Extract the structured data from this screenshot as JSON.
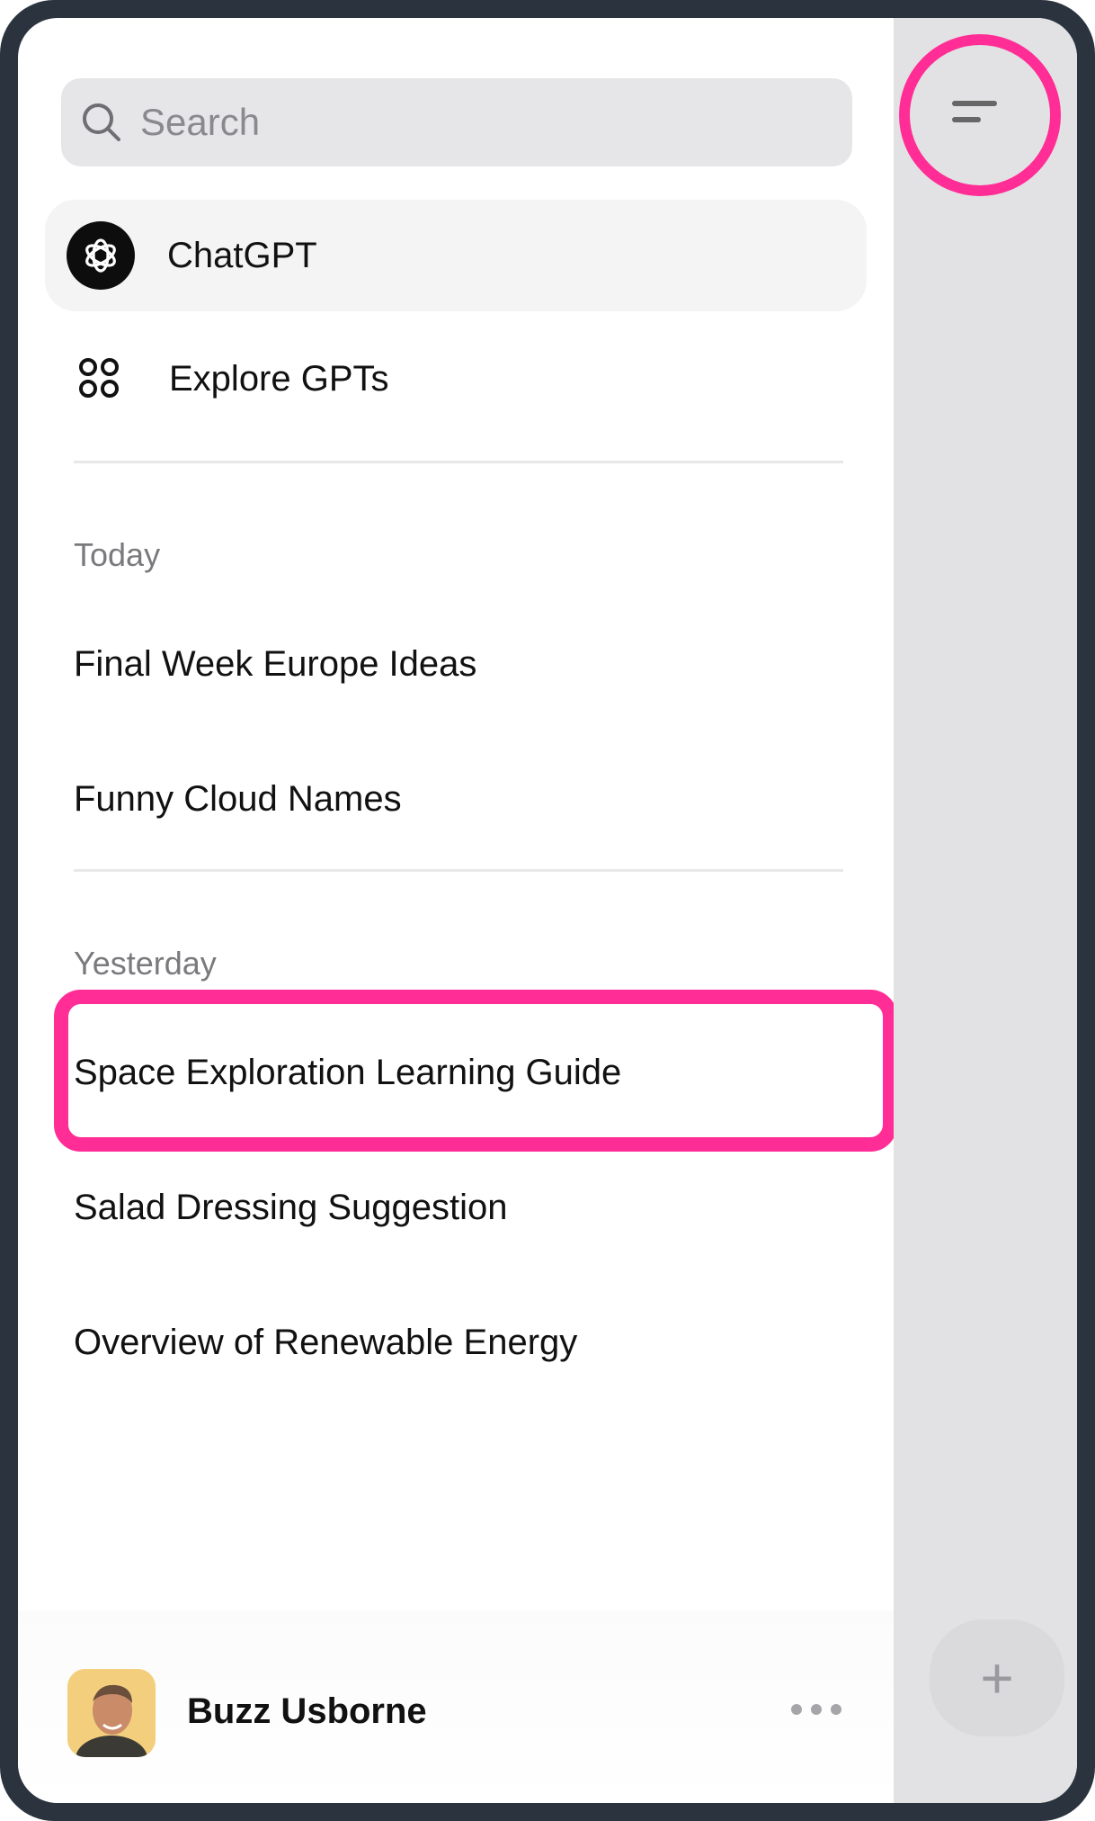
{
  "search": {
    "placeholder": "Search"
  },
  "nav": {
    "chatgpt_label": "ChatGPT",
    "explore_label": "Explore GPTs"
  },
  "sections": [
    {
      "header": "Today",
      "items": [
        "Final Week Europe Ideas",
        "Funny Cloud Names"
      ]
    },
    {
      "header": "Yesterday",
      "items": [
        "Space Exploration Learning Guide",
        "Salad Dressing Suggestion",
        "Overview of Renewable Energy"
      ]
    }
  ],
  "user": {
    "name": "Buzz Usborne"
  },
  "new_chat_label": "+",
  "colors": {
    "highlight": "#ff2d95",
    "frame": "#2b343e",
    "right_pane": "#e2e2e4"
  }
}
